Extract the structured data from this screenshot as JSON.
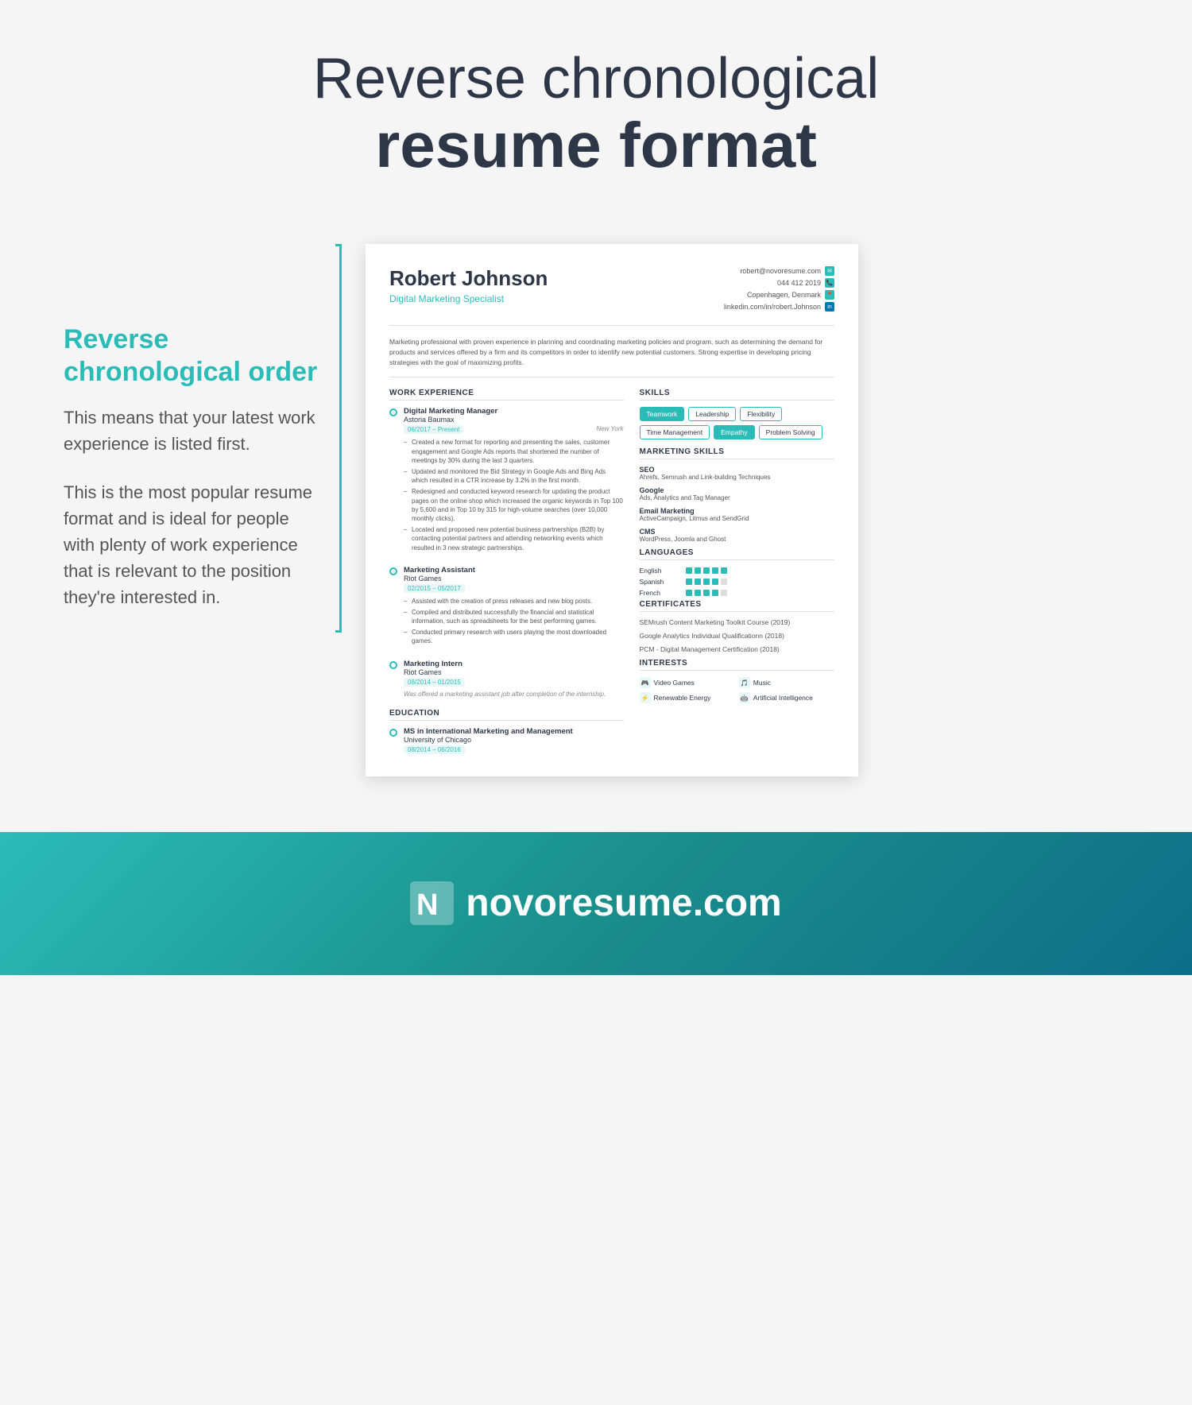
{
  "page": {
    "title_light": "Reverse chronological",
    "title_bold": "resume format"
  },
  "sidebar": {
    "heading": "Reverse chronological order",
    "text1": "This means that your latest work experience is listed first.",
    "text2": "This is the most popular resume format and is ideal for people with plenty of work experience that is relevant to the position they're interested in."
  },
  "resume": {
    "name": "Robert Johnson",
    "title": "Digital Marketing Specialist",
    "contact": {
      "email": "robert@novoresume.com",
      "phone": "044 412 2019",
      "location": "Copenhagen, Denmark",
      "linkedin": "linkedin.com/in/robert.Johnson"
    },
    "summary": "Marketing professional with proven experience in planning and coordinating marketing policies and program, such as determining the demand for products and services offered by a firm and its competitors in order to identify new potential customers. Strong expertise in developing pricing strategies with the goal of maximizing profits.",
    "work_experience_heading": "WORK EXPERIENCE",
    "skills_heading": "SKILLS",
    "marketing_skills_heading": "MARKETING SKILLS",
    "languages_heading": "LANGUAGES",
    "certificates_heading": "CERTIFICATES",
    "interests_heading": "INTERESTS",
    "education_heading": "EDUCATION",
    "jobs": [
      {
        "title": "Digital Marketing Manager",
        "company": "Astoria Baumax",
        "dates": "06/2017 – Present",
        "location": "New York",
        "bullets": [
          "Created a new format for reporting and presenting the sales, customer engagement and Google Ads reports that shortened the number of meetings by 30% during the last 3 quarters.",
          "Updated and monitored the Bid Strategy in Google Ads and Bing Ads which resulted in a CTR increase by 3.2% in the first month.",
          "Redesigned and conducted keyword research for updating the product pages on the online shop which increased the organic keywords in Top 100 by 5,600 and in Top 10 by 315 for high-volume searches (over 10,000 monthly clicks).",
          "Located and proposed new potential business partnerships (B2B) by contacting potential partners and attending networking events which resulted in 3 new strategic partnerships."
        ]
      },
      {
        "title": "Marketing Assistant",
        "company": "Riot Games",
        "dates": "02/2015 – 05/2017",
        "location": "",
        "bullets": [
          "Assisted with the creation of press releases and new blog posts.",
          "Compiled and distributed successfully the financial and statistical information, such as spreadsheets for the best performing games.",
          "Conducted primary research with users playing the most downloaded games."
        ]
      },
      {
        "title": "Marketing Intern",
        "company": "Riot Games",
        "dates": "08/2014 – 01/2015",
        "location": "",
        "note": "Was offered a marketing assistant job after completion of the internship.",
        "bullets": []
      }
    ],
    "skills": [
      {
        "label": "Teamwork",
        "style": "teal"
      },
      {
        "label": "Leadership",
        "style": "outline"
      },
      {
        "label": "Flexibility",
        "style": "outline"
      },
      {
        "label": "Time Management",
        "style": "outline"
      },
      {
        "label": "Empathy",
        "style": "teal"
      },
      {
        "label": "Problem Solving",
        "style": "outline"
      }
    ],
    "marketing_skills": [
      {
        "name": "SEO",
        "detail": "Ahrefs, Semrush and Link-building Techniques"
      },
      {
        "name": "Google",
        "detail": "Ads, Analytics and Tag Manager"
      },
      {
        "name": "Email Marketing",
        "detail": "ActiveCampaign, Litmus and SendGrid"
      },
      {
        "name": "CMS",
        "detail": "WordPress, Joomla and Ghost"
      }
    ],
    "languages": [
      {
        "name": "English",
        "dots": 5
      },
      {
        "name": "Spanish",
        "dots": 4
      },
      {
        "name": "French",
        "dots": 4
      }
    ],
    "certificates": [
      "SEMrush Content Marketing Toolkit Course (2019)",
      "Google Analytics Individual Qualificationn (2018)",
      "PCM - Digital Management Certification (2018)"
    ],
    "interests": [
      {
        "icon": "🎮",
        "label": "Video Games"
      },
      {
        "icon": "🎵",
        "label": "Music"
      },
      {
        "icon": "⚡",
        "label": "Renewable Energy"
      },
      {
        "icon": "🤖",
        "label": "Artificial Intelligence"
      }
    ],
    "education": [
      {
        "degree": "MS in International Marketing and Management",
        "school": "University of Chicago",
        "dates": "08/2014 – 06/2016"
      }
    ]
  },
  "footer": {
    "brand": "novoresume.com"
  }
}
